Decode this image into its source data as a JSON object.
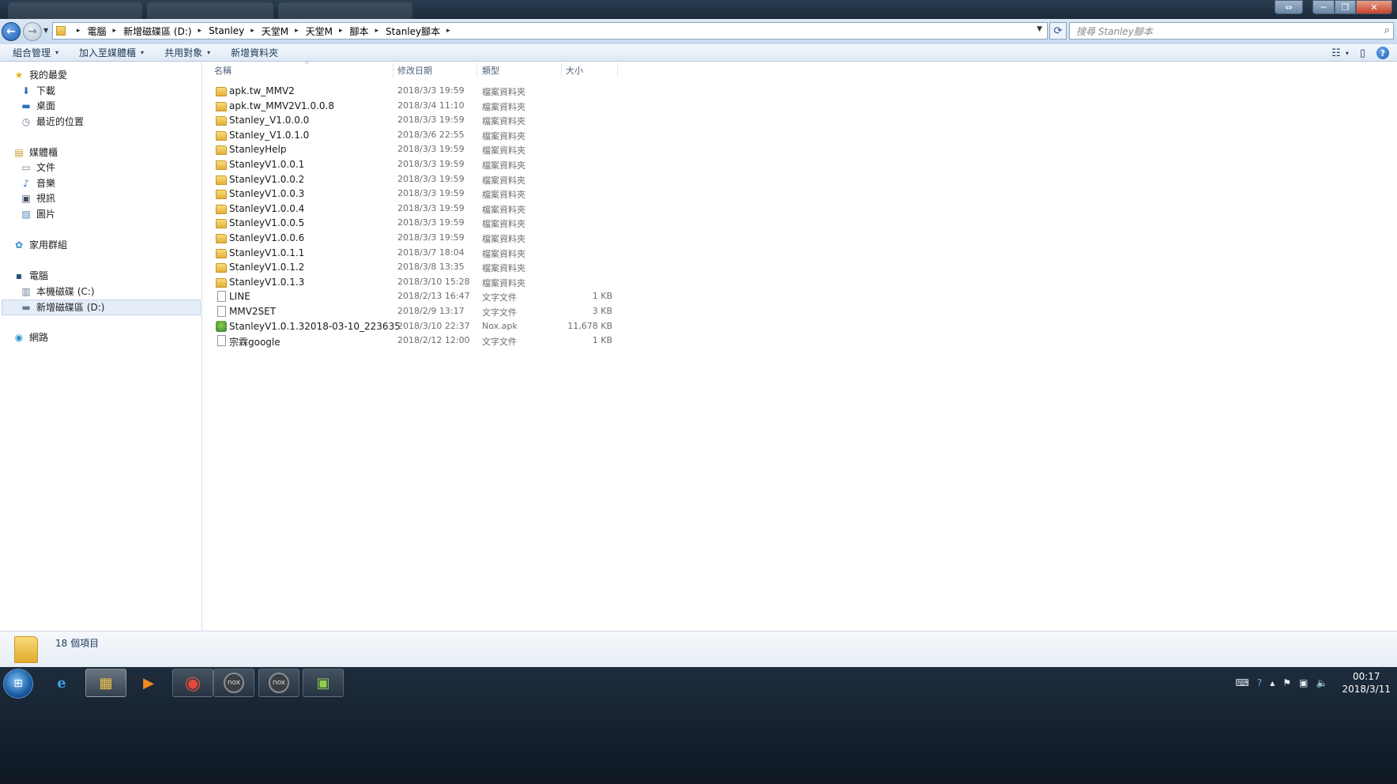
{
  "window": {
    "controls": {
      "restore": "⇔",
      "minimize": "─",
      "maximize": "❐",
      "close": "✕"
    }
  },
  "nav": {
    "back": "←",
    "forward": "→",
    "recent_dropdown": "▼",
    "breadcrumb": [
      "電腦",
      "新增磁碟區 (D:)",
      "Stanley",
      "天堂M",
      "天堂M",
      "腳本",
      "Stanley腳本"
    ],
    "breadcrumb_separator": "▸",
    "address_dropdown": "▼",
    "refresh": "⟳",
    "search_placeholder": "搜尋 Stanley腳本",
    "search_icon": "⌕"
  },
  "commands": {
    "organize": "組合管理",
    "add_to_library": "加入至媒體櫃",
    "share_with": "共用對象",
    "new_folder": "新增資料夾",
    "dropdown_glyph": "▾",
    "view_icon": "☷",
    "preview_icon": "▯",
    "help_icon": "?"
  },
  "sidebar": {
    "favorites": {
      "label": "我的最愛",
      "icon": "star-icon",
      "glyph": "★"
    },
    "favorites_items": [
      {
        "label": "下載",
        "glyph": "⬇"
      },
      {
        "label": "桌面",
        "glyph": "▬"
      },
      {
        "label": "最近的位置",
        "glyph": "◷"
      }
    ],
    "libraries": {
      "label": "媒體櫃",
      "glyph": "▤"
    },
    "library_items": [
      {
        "label": "文件",
        "glyph": "▭"
      },
      {
        "label": "音樂",
        "glyph": "♪"
      },
      {
        "label": "視訊",
        "glyph": "▣"
      },
      {
        "label": "圖片",
        "glyph": "▨"
      }
    ],
    "homegroup": {
      "label": "家用群組",
      "glyph": "✿"
    },
    "computer": {
      "label": "電腦",
      "glyph": "▪"
    },
    "computer_items": [
      {
        "label": "本機磁碟 (C:)",
        "glyph": "▥"
      },
      {
        "label": "新增磁碟區 (D:)",
        "glyph": "▬"
      }
    ],
    "network": {
      "label": "網路",
      "glyph": "◉"
    }
  },
  "columns": {
    "name": "名稱",
    "date": "修改日期",
    "type": "類型",
    "size": "大小",
    "sort_glyph": "^"
  },
  "files": [
    {
      "name": "apk.tw_MMV2",
      "date": "2018/3/3 19:59",
      "type": "檔案資料夾",
      "size": "",
      "kind": "folder"
    },
    {
      "name": "apk.tw_MMV2V1.0.0.8",
      "date": "2018/3/4 11:10",
      "type": "檔案資料夾",
      "size": "",
      "kind": "folder"
    },
    {
      "name": "Stanley_V1.0.0.0",
      "date": "2018/3/3 19:59",
      "type": "檔案資料夾",
      "size": "",
      "kind": "folder"
    },
    {
      "name": "Stanley_V1.0.1.0",
      "date": "2018/3/6 22:55",
      "type": "檔案資料夾",
      "size": "",
      "kind": "folder"
    },
    {
      "name": "StanleyHelp",
      "date": "2018/3/3 19:59",
      "type": "檔案資料夾",
      "size": "",
      "kind": "folder"
    },
    {
      "name": "StanleyV1.0.0.1",
      "date": "2018/3/3 19:59",
      "type": "檔案資料夾",
      "size": "",
      "kind": "folder"
    },
    {
      "name": "StanleyV1.0.0.2",
      "date": "2018/3/3 19:59",
      "type": "檔案資料夾",
      "size": "",
      "kind": "folder"
    },
    {
      "name": "StanleyV1.0.0.3",
      "date": "2018/3/3 19:59",
      "type": "檔案資料夾",
      "size": "",
      "kind": "folder"
    },
    {
      "name": "StanleyV1.0.0.4",
      "date": "2018/3/3 19:59",
      "type": "檔案資料夾",
      "size": "",
      "kind": "folder"
    },
    {
      "name": "StanleyV1.0.0.5",
      "date": "2018/3/3 19:59",
      "type": "檔案資料夾",
      "size": "",
      "kind": "folder"
    },
    {
      "name": "StanleyV1.0.0.6",
      "date": "2018/3/3 19:59",
      "type": "檔案資料夾",
      "size": "",
      "kind": "folder"
    },
    {
      "name": "StanleyV1.0.1.1",
      "date": "2018/3/7 18:04",
      "type": "檔案資料夾",
      "size": "",
      "kind": "folder"
    },
    {
      "name": "StanleyV1.0.1.2",
      "date": "2018/3/8 13:35",
      "type": "檔案資料夾",
      "size": "",
      "kind": "folder"
    },
    {
      "name": "StanleyV1.0.1.3",
      "date": "2018/3/10 15:28",
      "type": "檔案資料夾",
      "size": "",
      "kind": "folder"
    },
    {
      "name": "LINE",
      "date": "2018/2/13 16:47",
      "type": "文字文件",
      "size": "1 KB",
      "kind": "doc"
    },
    {
      "name": "MMV2SET",
      "date": "2018/2/9 13:17",
      "type": "文字文件",
      "size": "3 KB",
      "kind": "doc"
    },
    {
      "name": "StanleyV1.0.1.32018-03-10_223635",
      "date": "2018/3/10 22:37",
      "type": "Nox.apk",
      "size": "11,678 KB",
      "kind": "apk"
    },
    {
      "name": "宗霖google",
      "date": "2018/2/12 12:00",
      "type": "文字文件",
      "size": "1 KB",
      "kind": "doc"
    }
  ],
  "status": {
    "item_count": "18 個項目"
  },
  "taskbar": {
    "start": "⊞",
    "apps": [
      {
        "name": "internet-explorer",
        "glyph": "e",
        "state": "none"
      },
      {
        "name": "windows-explorer",
        "glyph": "▦",
        "state": "active"
      },
      {
        "name": "media-player",
        "glyph": "▶",
        "state": "none"
      },
      {
        "name": "chrome",
        "glyph": "◉",
        "state": "open"
      },
      {
        "name": "nox-player",
        "glyph": "nox",
        "state": "open"
      },
      {
        "name": "nox-multi",
        "glyph": "nox",
        "state": "open"
      },
      {
        "name": "script-tool",
        "glyph": "▣",
        "state": "open"
      }
    ],
    "tray": {
      "keyboard": "⌨",
      "help": "?",
      "arrow": "▲",
      "flag": "⚑",
      "network": "▣",
      "volume": "🔈"
    },
    "clock_time": "00:17",
    "clock_date": "2018/3/11"
  },
  "colors": {
    "accent": "#1d5fb6",
    "selection": "#e5eef8",
    "folder": "#e3b13a"
  }
}
